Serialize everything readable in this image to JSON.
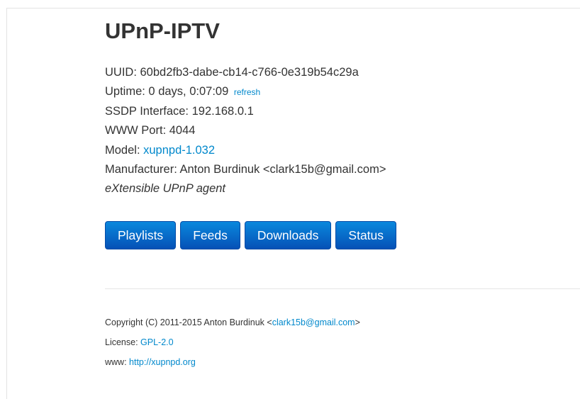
{
  "header": {
    "title": "UPnP-IPTV"
  },
  "info": {
    "uuid": "UUID: 60bd2fb3-dabe-cb14-c766-0e319b54c29a",
    "uptime": "Uptime: 0 days, 0:07:09",
    "refresh_label": "refresh",
    "ssdp_interface": "SSDP Interface: 192.168.0.1",
    "www_port": "WWW Port: 4044",
    "model_prefix": "Model: ",
    "model_link": "xupnpd-1.032",
    "manufacturer": "Manufacturer: Anton Burdinuk <clark15b@gmail.com>",
    "tagline": "eXtensible UPnP agent"
  },
  "nav": {
    "buttons": [
      {
        "label": "Playlists"
      },
      {
        "label": "Feeds"
      },
      {
        "label": "Downloads"
      },
      {
        "label": "Status"
      }
    ]
  },
  "footer": {
    "copyright_prefix": "Copyright (C) 2011-2015 Anton Burdinuk <",
    "copyright_email": "clark15b@gmail.com",
    "copyright_suffix": ">",
    "license_prefix": "License: ",
    "license_link": "GPL-2.0",
    "www_prefix": "www: ",
    "www_link": "http://xupnpd.org"
  },
  "colors": {
    "link": "#0088cc",
    "button_top": "#0a88dd",
    "button_bottom": "#0551b6",
    "text": "#333333"
  }
}
